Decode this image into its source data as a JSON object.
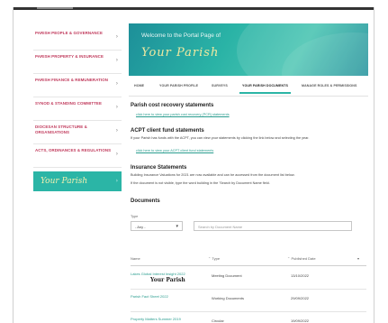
{
  "sidebar": {
    "items": [
      {
        "label": "PARISH PEOPLE & GOVERNANCE"
      },
      {
        "label": "PARISH PROPERTY & INSURANCE"
      },
      {
        "label": "PARISH FINANCE & REMUNERATION"
      },
      {
        "label": "SYNOD & STANDING COMMITTEE"
      },
      {
        "label": "DIOCESAN STRUCTURE & ORGANISATIONS"
      },
      {
        "label": "ACTS, ORDINANCES & REGULATIONS"
      }
    ],
    "brand": "Your Parish",
    "chevron": "›"
  },
  "banner": {
    "welcome": "Welcome to the Portal Page of",
    "parish": "Your Parish"
  },
  "tabs": [
    {
      "label": "HOME"
    },
    {
      "label": "YOUR PARISH PROFILE"
    },
    {
      "label": "SURVEYS"
    },
    {
      "label": "YOUR PARISH DOCUMENTS"
    },
    {
      "label": "MANAGE ROLES & PERMISSIONS"
    }
  ],
  "sections": {
    "cost_recovery": {
      "heading": "Parish cost recovery statements",
      "link": "click here to view your parish cost recovery (PCR) statements"
    },
    "acpt": {
      "heading": "ACPT client fund statements",
      "body": "If your Parish has funds with the ACPT, you can view your statements by clicking the link below and selecting the year.",
      "link": "click here to view your ACPT client fund statements"
    },
    "insurance": {
      "heading": "Insurance Statements",
      "body1": "Building Insurance Valuations for 2021 are now available and can be accessed from the document list below.",
      "body2": "If the document is not visible, type the word building in the 'Search by Document Name field."
    }
  },
  "documents": {
    "heading": "Documents",
    "type_label": "Type",
    "type_value": "- Any -",
    "search_placeholder": "Search by Document Name",
    "columns": [
      "Name",
      "Type",
      "Published Date"
    ],
    "rows": [
      {
        "name": "Lakes Global Interest Insight 2022",
        "type": "Meeting Document",
        "date": "13/10/2022"
      },
      {
        "name": "Parish Fact Sheet 2022",
        "type": "Working Documents",
        "date": "29/09/2022"
      },
      {
        "name": "Property Matters Summer 2019",
        "type": "Circular",
        "date": "19/09/2022"
      }
    ],
    "overlay_text": "Your Parish"
  }
}
